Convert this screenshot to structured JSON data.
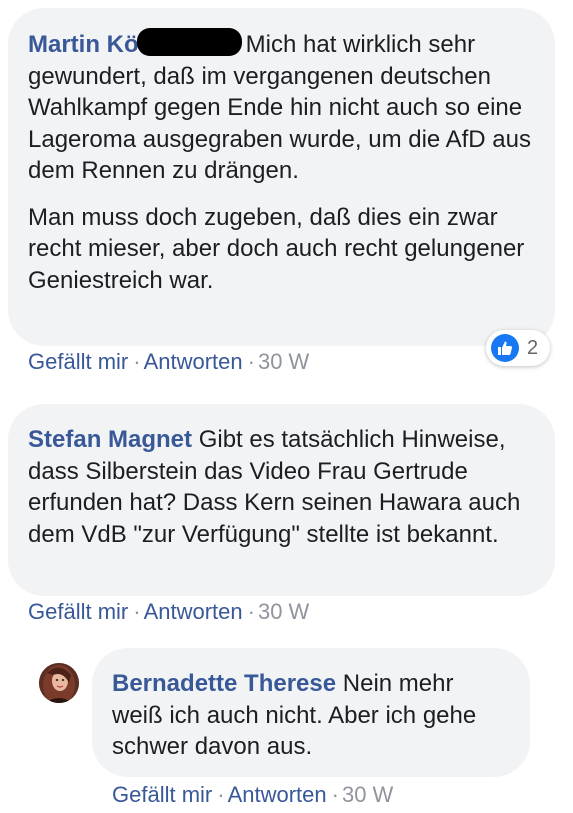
{
  "comments": [
    {
      "author": "Martin Kö",
      "paragraph_1": "Mich hat wirklich sehr gewundert, daß im vergangenen deutschen Wahlkampf gegen Ende hin nicht auch so eine Lageroma ausgegraben wurde, um die AfD aus dem Rennen zu drängen.",
      "paragraph_2": "Man muss doch zugeben, daß dies ein zwar recht mieser, aber doch auch recht gelungener Geniestreich war.",
      "like_label": "Gefällt mir",
      "reply_label": "Antworten",
      "timestamp": "30 W",
      "reaction_count": "2"
    },
    {
      "author": "Stefan Magnet",
      "text": "Gibt es tatsächlich Hinweise, dass Silberstein das Video Frau Gertrude erfunden hat? Dass Kern seinen Hawara auch dem VdB \"zur Verfügung\" stellte ist bekannt.",
      "like_label": "Gefällt mir",
      "reply_label": "Antworten",
      "timestamp": "30 W"
    }
  ],
  "reply": {
    "author": "Bernadette Therese",
    "text": "Nein mehr weiß ich auch nicht. Aber ich gehe schwer davon aus.",
    "like_label": "Gefällt mir",
    "reply_label": "Antworten",
    "timestamp": "30 W"
  },
  "separator": "·",
  "colors": {
    "author": "#385898",
    "bubble": "#f2f3f5",
    "like": "#1877f2",
    "meta": "#90949c"
  }
}
